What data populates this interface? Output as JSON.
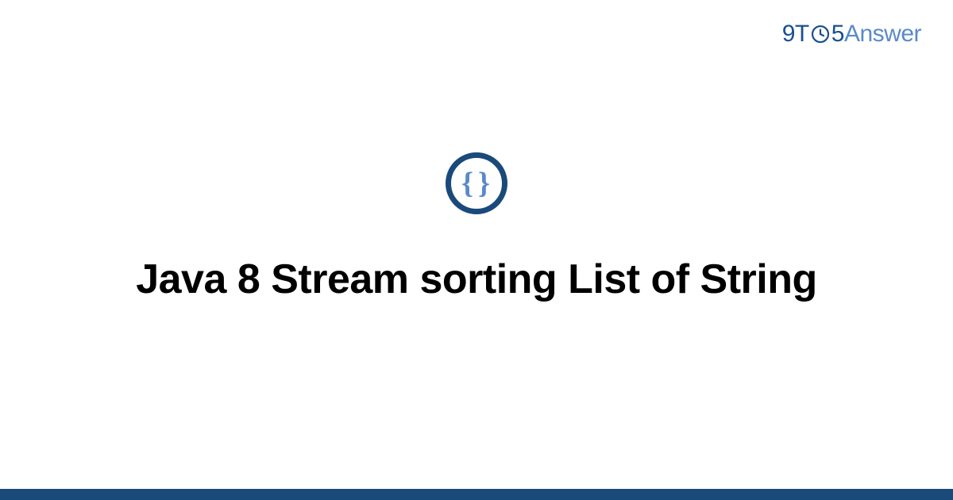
{
  "brand": {
    "part_9t": "9T",
    "part_5": "5",
    "part_answer": "Answer"
  },
  "icon": {
    "semantic": "code-braces-icon",
    "glyph_left": "{",
    "glyph_right": "}"
  },
  "title": "Java 8 Stream sorting List of String",
  "colors": {
    "accent_dark": "#1a4a7a",
    "accent_light": "#5a8ac8",
    "brand_blue": "#1a4f8f"
  }
}
